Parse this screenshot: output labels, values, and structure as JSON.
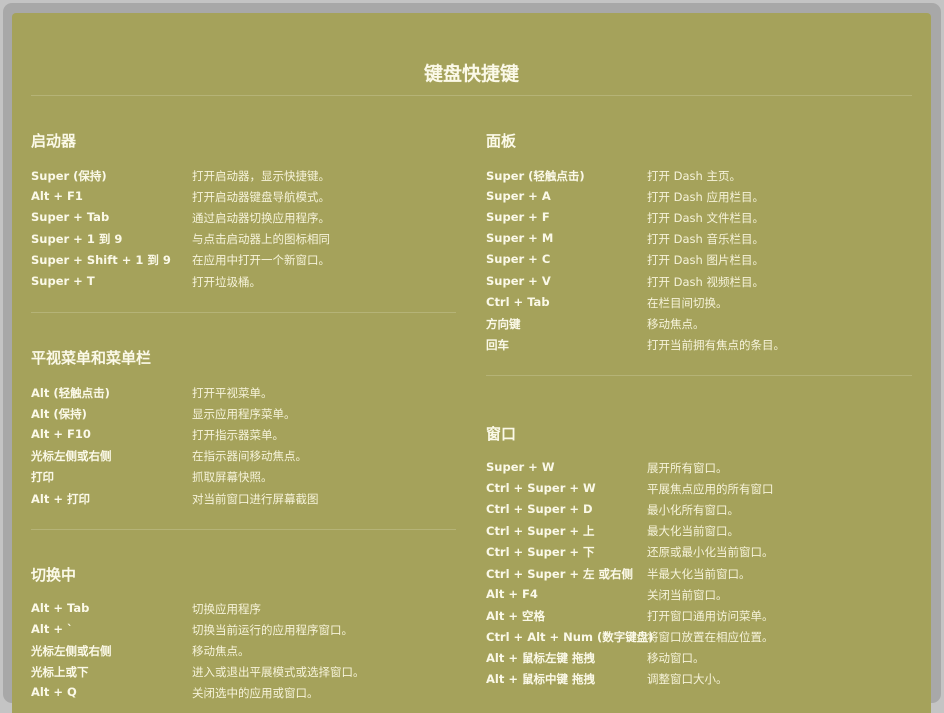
{
  "title": "键盘快捷键",
  "sections": {
    "launcher": {
      "title": "启动器",
      "items": [
        {
          "key": "Super (保持)",
          "desc": "打开启动器，显示快捷键。"
        },
        {
          "key": "Alt + F1",
          "desc": "打开启动器键盘导航模式。"
        },
        {
          "key": "Super + Tab",
          "desc": "通过启动器切换应用程序。"
        },
        {
          "key": "Super + 1 到 9",
          "desc": "与点击启动器上的图标相同"
        },
        {
          "key": "Super + Shift + 1 到 9",
          "desc": "在应用中打开一个新窗口。"
        },
        {
          "key": "Super + T",
          "desc": "打开垃圾桶。"
        }
      ]
    },
    "hud": {
      "title": "平视菜单和菜单栏",
      "items": [
        {
          "key": "Alt (轻触点击)",
          "desc": "打开平视菜单。"
        },
        {
          "key": "Alt (保持)",
          "desc": "显示应用程序菜单。"
        },
        {
          "key": "Alt + F10",
          "desc": "打开指示器菜单。"
        },
        {
          "key": "光标左侧或右侧",
          "desc": "在指示器间移动焦点。"
        },
        {
          "key": "打印",
          "desc": "抓取屏幕快照。"
        },
        {
          "key": "Alt + 打印",
          "desc": "对当前窗口进行屏幕截图"
        }
      ]
    },
    "switching": {
      "title": "切换中",
      "items": [
        {
          "key": "Alt + Tab",
          "desc": "切换应用程序"
        },
        {
          "key": "Alt + `",
          "desc": "切换当前运行的应用程序窗口。"
        },
        {
          "key": "光标左侧或右侧",
          "desc": "移动焦点。"
        },
        {
          "key": "光标上或下",
          "desc": "进入或退出平展模式或选择窗口。"
        },
        {
          "key": "Alt + Q",
          "desc": "关闭选中的应用或窗口。"
        }
      ]
    },
    "dash": {
      "title": "面板",
      "items": [
        {
          "key": "Super (轻触点击)",
          "desc": "打开 Dash 主页。"
        },
        {
          "key": "Super + A",
          "desc": "打开 Dash 应用栏目。"
        },
        {
          "key": "Super + F",
          "desc": "打开 Dash 文件栏目。"
        },
        {
          "key": "Super + M",
          "desc": "打开 Dash 音乐栏目。"
        },
        {
          "key": "Super + C",
          "desc": "打开 Dash 图片栏目。"
        },
        {
          "key": "Super + V",
          "desc": "打开 Dash 视频栏目。"
        },
        {
          "key": "Ctrl + Tab",
          "desc": "在栏目间切换。"
        },
        {
          "key": "方向键",
          "desc": "移动焦点。"
        },
        {
          "key": "回车",
          "desc": "打开当前拥有焦点的条目。"
        }
      ]
    },
    "windows": {
      "title": "窗口",
      "items": [
        {
          "key": "Super + W",
          "desc": "展开所有窗口。"
        },
        {
          "key": "Ctrl + Super + W",
          "desc": "平展焦点应用的所有窗口"
        },
        {
          "key": "Ctrl + Super + D",
          "desc": "最小化所有窗口。"
        },
        {
          "key": "Ctrl + Super + 上",
          "desc": "最大化当前窗口。"
        },
        {
          "key": "Ctrl + Super + 下",
          "desc": "还原或最小化当前窗口。"
        },
        {
          "key": "Ctrl + Super + 左 或右侧",
          "desc": "半最大化当前窗口。"
        },
        {
          "key": "Alt + F4",
          "desc": "关闭当前窗口。"
        },
        {
          "key": "Alt + 空格",
          "desc": "打开窗口通用访问菜单。"
        },
        {
          "key": "Ctrl + Alt + Num (数字键盘)",
          "desc": "将窗口放置在相应位置。"
        },
        {
          "key": "Alt + 鼠标左键 拖拽",
          "desc": "移动窗口。"
        },
        {
          "key": "Alt + 鼠标中键 拖拽",
          "desc": "调整窗口大小。"
        }
      ]
    }
  }
}
